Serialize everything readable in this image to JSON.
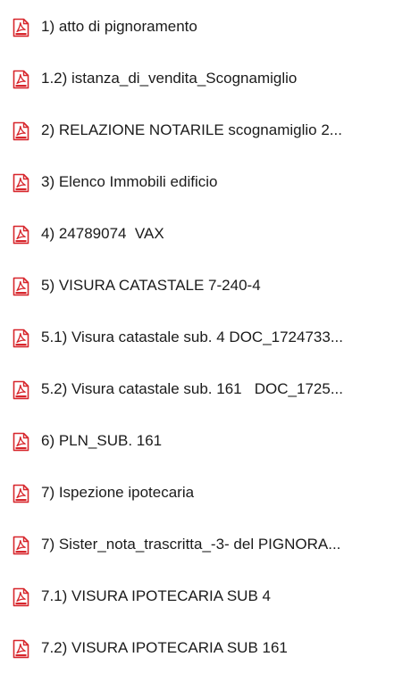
{
  "files": [
    {
      "name": "1) atto di pignoramento",
      "icon": "pdf-file-icon"
    },
    {
      "name": "1.2) istanza_di_vendita_Scognamiglio",
      "icon": "pdf-file-icon"
    },
    {
      "name": "2) RELAZIONE NOTARILE scognamiglio 2...",
      "icon": "pdf-file-icon"
    },
    {
      "name": "3) Elenco Immobili edificio",
      "icon": "pdf-file-icon"
    },
    {
      "name": "4) 24789074  VAX",
      "icon": "pdf-file-icon"
    },
    {
      "name": "5) VISURA CATASTALE 7-240-4",
      "icon": "pdf-file-icon"
    },
    {
      "name": "5.1) Visura catastale sub. 4 DOC_1724733...",
      "icon": "pdf-file-icon"
    },
    {
      "name": "5.2) Visura catastale sub. 161   DOC_1725...",
      "icon": "pdf-file-icon"
    },
    {
      "name": "6) PLN_SUB. 161",
      "icon": "pdf-file-icon"
    },
    {
      "name": "7) Ispezione ipotecaria",
      "icon": "pdf-file-icon"
    },
    {
      "name": "7) Sister_nota_trascritta_-3- del PIGNORA...",
      "icon": "pdf-file-icon"
    },
    {
      "name": "7.1) VISURA IPOTECARIA SUB 4",
      "icon": "pdf-file-icon"
    },
    {
      "name": "7.2) VISURA IPOTECARIA SUB 161",
      "icon": "pdf-file-icon"
    }
  ],
  "colors": {
    "icon_red": "#d7262c",
    "icon_page": "#ffffff",
    "text": "#1b1b1b"
  }
}
